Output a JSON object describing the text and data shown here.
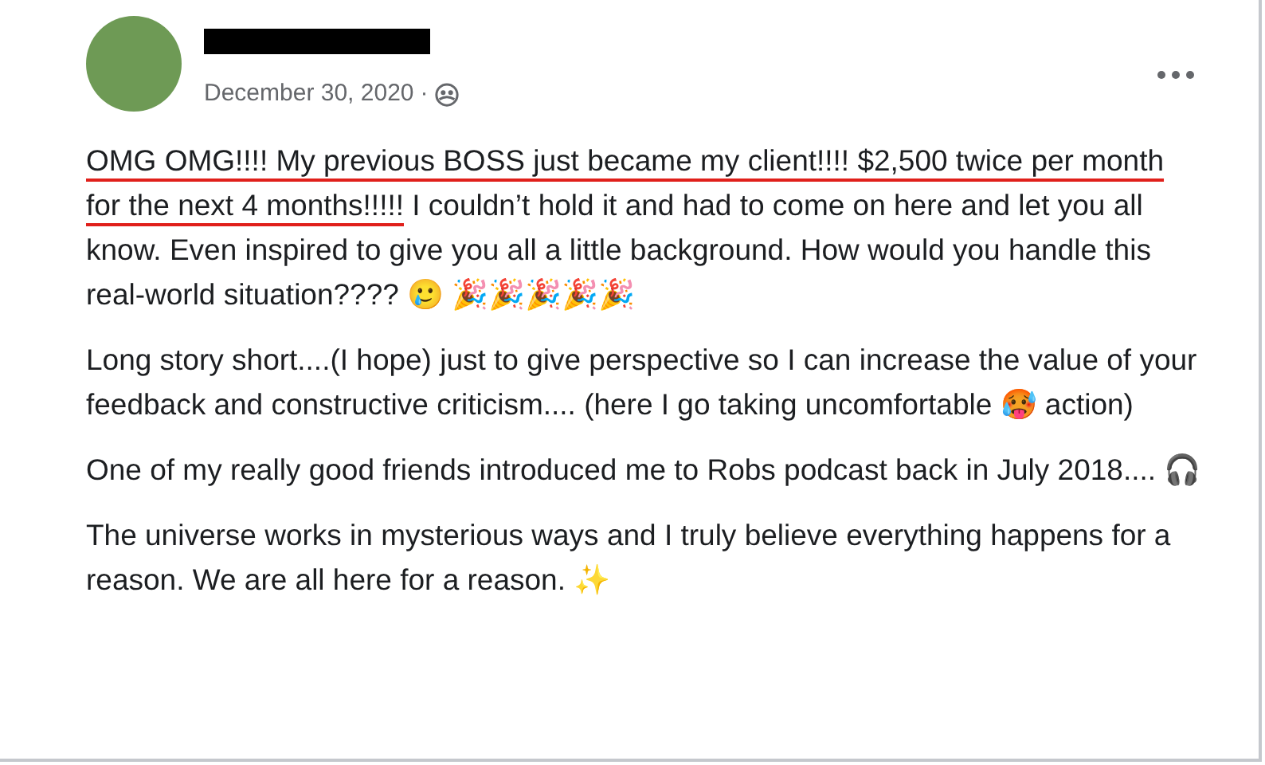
{
  "post": {
    "date": "December 30, 2020",
    "separator": "·",
    "paragraphs": [
      {
        "highlight": "OMG OMG!!!! My previous BOSS just became my client!!!! $2,500 twice per month for the next 4 months!!!!!",
        "text": " I couldn’t hold it and had to come on here and let you all know. Even inspired to give you all a little background. How would you handle this real-world situation???? 🥲 🎉🎉🎉🎉🎉"
      },
      {
        "text": "Long story short....(I hope) just to give perspective so I can increase the value of your feedback and constructive criticism.... (here I go taking uncomfortable 🥵 action)"
      },
      {
        "text": "One of my really good friends introduced me to Robs podcast back in July 2018.... 🎧"
      },
      {
        "text": "The universe works in mysterious ways and I truly believe everything happens for a reason. We are all here for a reason. ✨"
      }
    ]
  }
}
